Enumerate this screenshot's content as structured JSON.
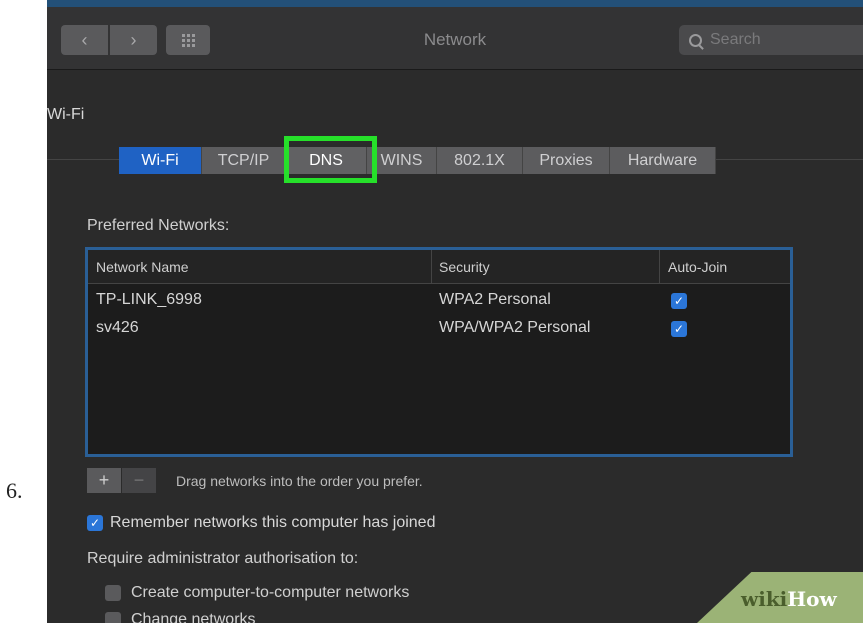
{
  "step_number": "6.",
  "window": {
    "title": "Network",
    "search_placeholder": "Search",
    "back_glyph": "‹",
    "forward_glyph": "›"
  },
  "panel": {
    "title": "Wi-Fi"
  },
  "tabs": [
    {
      "label": "Wi-Fi",
      "active": true
    },
    {
      "label": "TCP/IP",
      "active": false
    },
    {
      "label": "DNS",
      "active": false,
      "highlighted": true
    },
    {
      "label": "WINS",
      "active": false
    },
    {
      "label": "802.1X",
      "active": false
    },
    {
      "label": "Proxies",
      "active": false
    },
    {
      "label": "Hardware",
      "active": false
    }
  ],
  "preferred_networks": {
    "label": "Preferred Networks:",
    "columns": [
      "Network Name",
      "Security",
      "Auto-Join"
    ],
    "rows": [
      {
        "name": "TP-LINK_6998",
        "security": "WPA2 Personal",
        "auto_join": true
      },
      {
        "name": "sv426",
        "security": "WPA/WPA2 Personal",
        "auto_join": true
      }
    ]
  },
  "controls": {
    "add": "+",
    "remove": "−",
    "drag_hint": "Drag networks into the order you prefer."
  },
  "options": {
    "remember_label": "Remember networks this computer has joined",
    "remember_checked": true,
    "require_label": "Require administrator authorisation to:",
    "admin_options": [
      {
        "label": "Create computer-to-computer networks",
        "checked": false
      },
      {
        "label": "Change networks",
        "checked": false
      }
    ]
  },
  "watermark": {
    "wiki": "wiki",
    "how": "How"
  },
  "colors": {
    "accent": "#1f62c4",
    "highlight": "#26e02a",
    "checkbox": "#2b76d8",
    "table_border": "#2a5f96"
  }
}
